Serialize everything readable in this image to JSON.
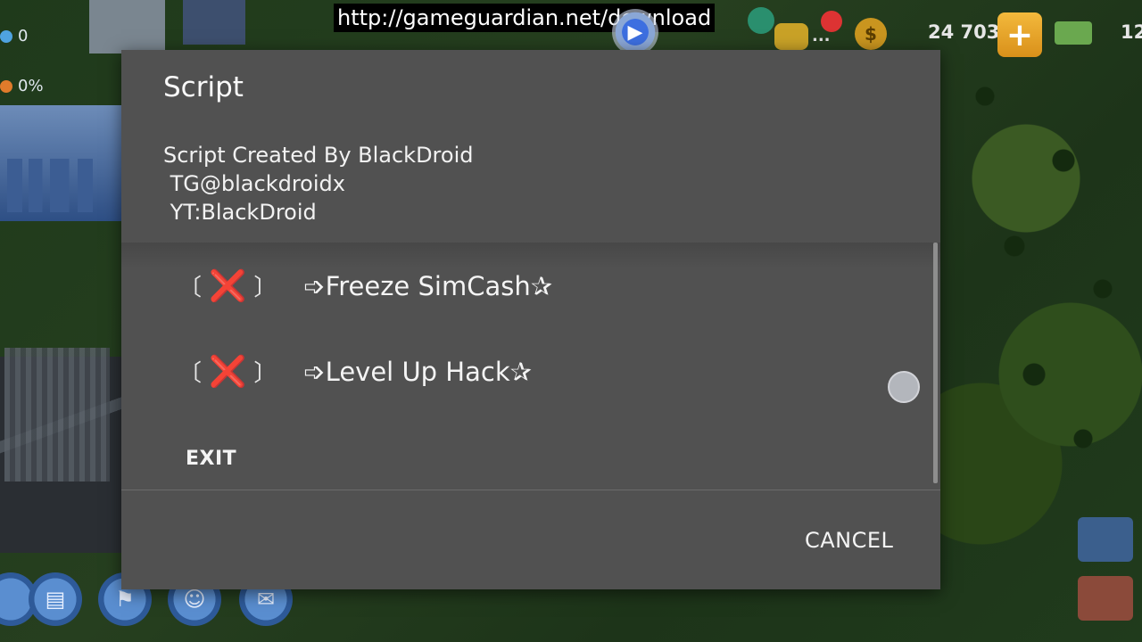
{
  "hud": {
    "url_text": "http://gameguardian.net/download",
    "population": "0",
    "happiness": "0%",
    "simoleons": "24 703",
    "simcash": "12",
    "plus_symbol": "+",
    "ellipsis": "...",
    "coin_symbol": "$",
    "play_symbol": "▶"
  },
  "dialog": {
    "title": "Script",
    "message_lines": [
      "Script Created By BlackDroid",
      " TG@blackdroidx",
      " YT:BlackDroid"
    ],
    "items": [
      {
        "open": "〔",
        "mark": "❌",
        "close": "〕",
        "label": "➩Freeze SimCash✰"
      },
      {
        "open": "〔",
        "mark": "❌",
        "close": "〕",
        "label": "➩Level Up Hack✰"
      }
    ],
    "exit_label": "EXIT",
    "cancel_label": "CANCEL"
  },
  "icons": {
    "population": "person-icon",
    "happiness": "smiley-icon",
    "coin": "coin-icon",
    "plus": "plus-icon",
    "bills": "cash-bills-icon",
    "gameguardian": "gameguardian-icon",
    "floating": "floating-bubble-icon"
  },
  "colors": {
    "dialog_bg": "#515151",
    "x_mark": "#e0262d",
    "plus_button": "#f3b93c",
    "floating_dot": "#b9bcc2"
  }
}
